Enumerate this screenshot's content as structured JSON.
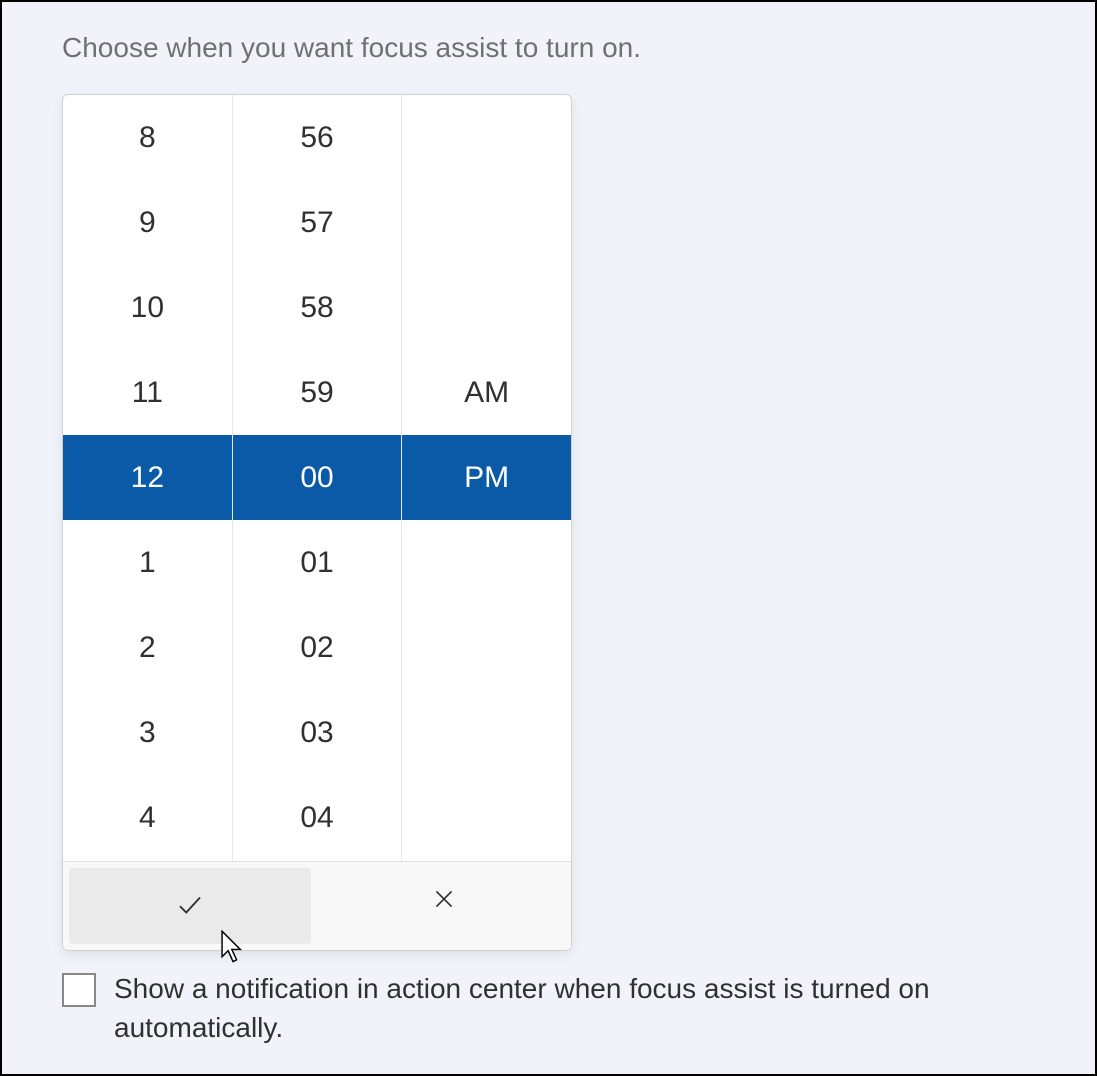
{
  "instruction": "Choose when you want focus assist to turn on.",
  "time_picker": {
    "hours": [
      "8",
      "9",
      "10",
      "11",
      "12",
      "1",
      "2",
      "3",
      "4"
    ],
    "minutes": [
      "56",
      "57",
      "58",
      "59",
      "00",
      "01",
      "02",
      "03",
      "04"
    ],
    "periods": [
      "",
      "",
      "",
      "AM",
      "PM",
      "",
      "",
      "",
      ""
    ],
    "selected_index": 4,
    "selected_hour": "12",
    "selected_minute": "00",
    "selected_period": "PM"
  },
  "checkbox": {
    "checked": false,
    "label": "Show a notification in action center when focus assist is turned on automatically."
  },
  "colors": {
    "selection": "#0a5aa8",
    "background": "#f0f4fa"
  }
}
